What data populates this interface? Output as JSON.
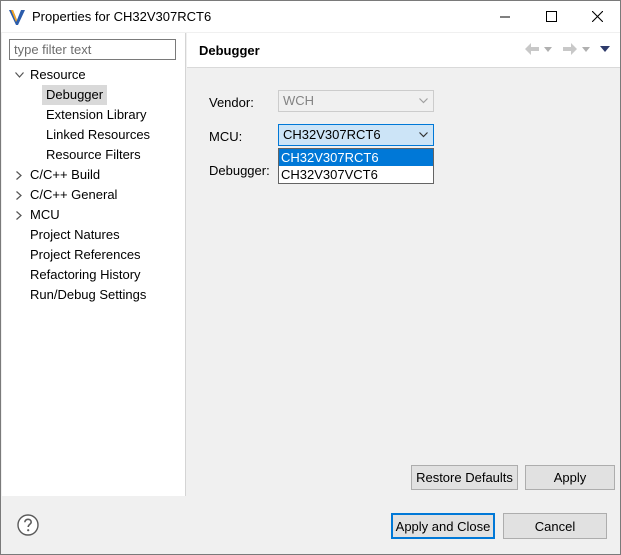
{
  "window": {
    "title": "Properties for CH32V307RCT6"
  },
  "filter": {
    "placeholder": "type filter text"
  },
  "tree": {
    "resource": "Resource",
    "debugger": "Debugger",
    "extension_library": "Extension Library",
    "linked_resources": "Linked Resources",
    "resource_filters": "Resource Filters",
    "cpp_build": "C/C++ Build",
    "cpp_general": "C/C++ General",
    "mcu": "MCU",
    "project_natures": "Project Natures",
    "project_references": "Project References",
    "refactoring_history": "Refactoring History",
    "run_debug_settings": "Run/Debug Settings"
  },
  "page": {
    "title": "Debugger",
    "vendor_label": "Vendor:",
    "vendor_value": "WCH",
    "mcu_label": "MCU:",
    "mcu_value": "CH32V307RCT6",
    "debugger_label": "Debugger:",
    "mcu_options": [
      "CH32V307RCT6",
      "CH32V307VCT6"
    ]
  },
  "buttons": {
    "restore_defaults": "Restore Defaults",
    "apply": "Apply",
    "apply_and_close": "Apply and Close",
    "cancel": "Cancel"
  },
  "colors": {
    "accent": "#0078d7",
    "selection": "#d9d9d9"
  }
}
